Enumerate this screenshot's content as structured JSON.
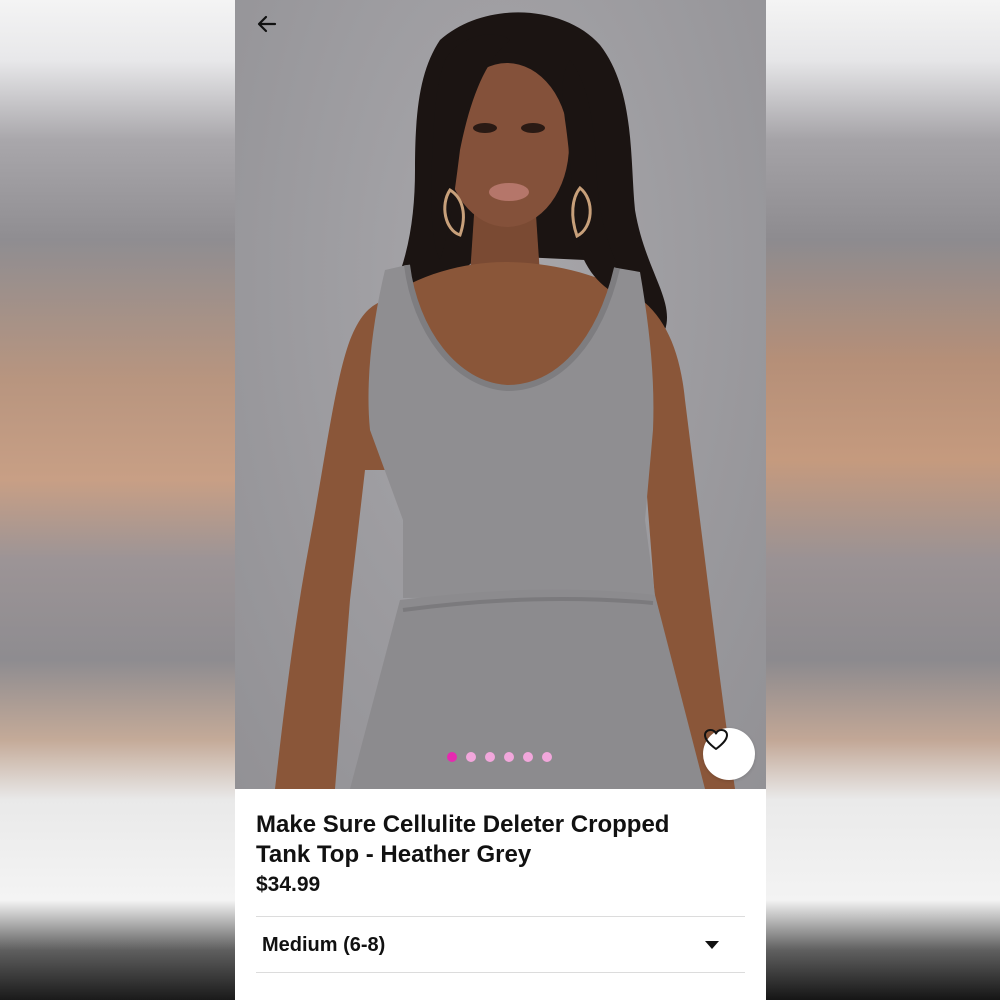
{
  "product": {
    "title_line1": "Make Sure Cellulite Deleter Cropped",
    "title_line2": "Tank Top - Heather Grey",
    "price": "$34.99"
  },
  "gallery": {
    "image_count": 6,
    "active_index": 0
  },
  "size_selector": {
    "selected": "Medium (6-8)"
  },
  "icons": {
    "back": "back-arrow-icon",
    "favorite": "heart-icon",
    "dropdown": "chevron-down-icon"
  },
  "colors": {
    "accent": "#e62ab0",
    "dot_inactive": "#f2a7dc",
    "text": "#111111",
    "image_background": "#9e9da1"
  }
}
